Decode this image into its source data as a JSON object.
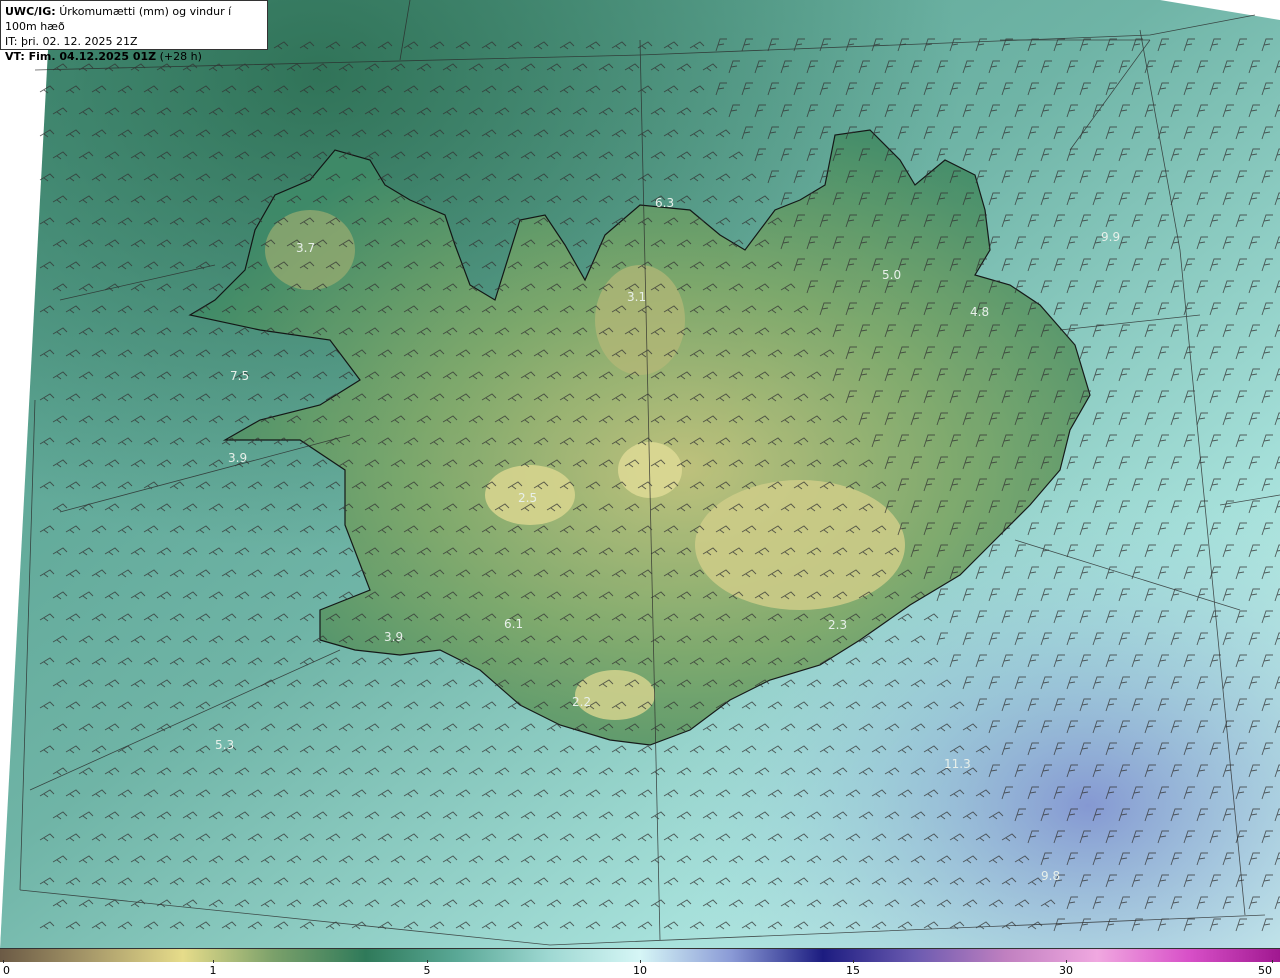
{
  "header": {
    "line1_bold": "UWC/IG:",
    "line1_text": "Úrkomumætti (mm) og vindur í 100m hæð",
    "line2": "IT: þri. 02. 12. 2025 21Z",
    "line3_bold": "VT: Fim. 04.12.2025 01Z",
    "line3_text": "(+28 h)"
  },
  "map_labels": [
    {
      "name": "label-westfjords",
      "text": "3.7"
    },
    {
      "name": "label-west-sea",
      "text": "7.5"
    },
    {
      "name": "label-snaefellsnes",
      "text": "3.9"
    },
    {
      "name": "label-reykjanes",
      "text": "3.9"
    },
    {
      "name": "label-southwest-sea",
      "text": "5.3"
    },
    {
      "name": "label-south",
      "text": "6.1"
    },
    {
      "name": "label-north",
      "text": "3.1"
    },
    {
      "name": "label-northeast",
      "text": "5.0"
    },
    {
      "name": "label-east",
      "text": "4.8"
    },
    {
      "name": "label-east-sea",
      "text": "9.9"
    },
    {
      "name": "label-southeast-sea",
      "text": "11.3"
    },
    {
      "name": "label-south-sea",
      "text": "9.8"
    },
    {
      "name": "label-southeast",
      "text": "2.3"
    },
    {
      "name": "label-central",
      "text": "2.5"
    },
    {
      "name": "label-south-glacier",
      "text": "2.2"
    },
    {
      "name": "label-north-coast",
      "text": "6.3"
    }
  ],
  "colorbar": {
    "ticks": [
      "0",
      "1",
      "5",
      "10",
      "15",
      "30",
      "50"
    ],
    "colors": [
      "#6b5a45",
      "#a89a6a",
      "#e6dc8a",
      "#7aa06a",
      "#2f7a5a",
      "#5aa896",
      "#9ed8d2",
      "#d6f6f6",
      "#8a9ad6",
      "#1c1c80",
      "#6a5ab0",
      "#c080c0",
      "#f0a8e0",
      "#d850c8",
      "#a01890"
    ]
  }
}
